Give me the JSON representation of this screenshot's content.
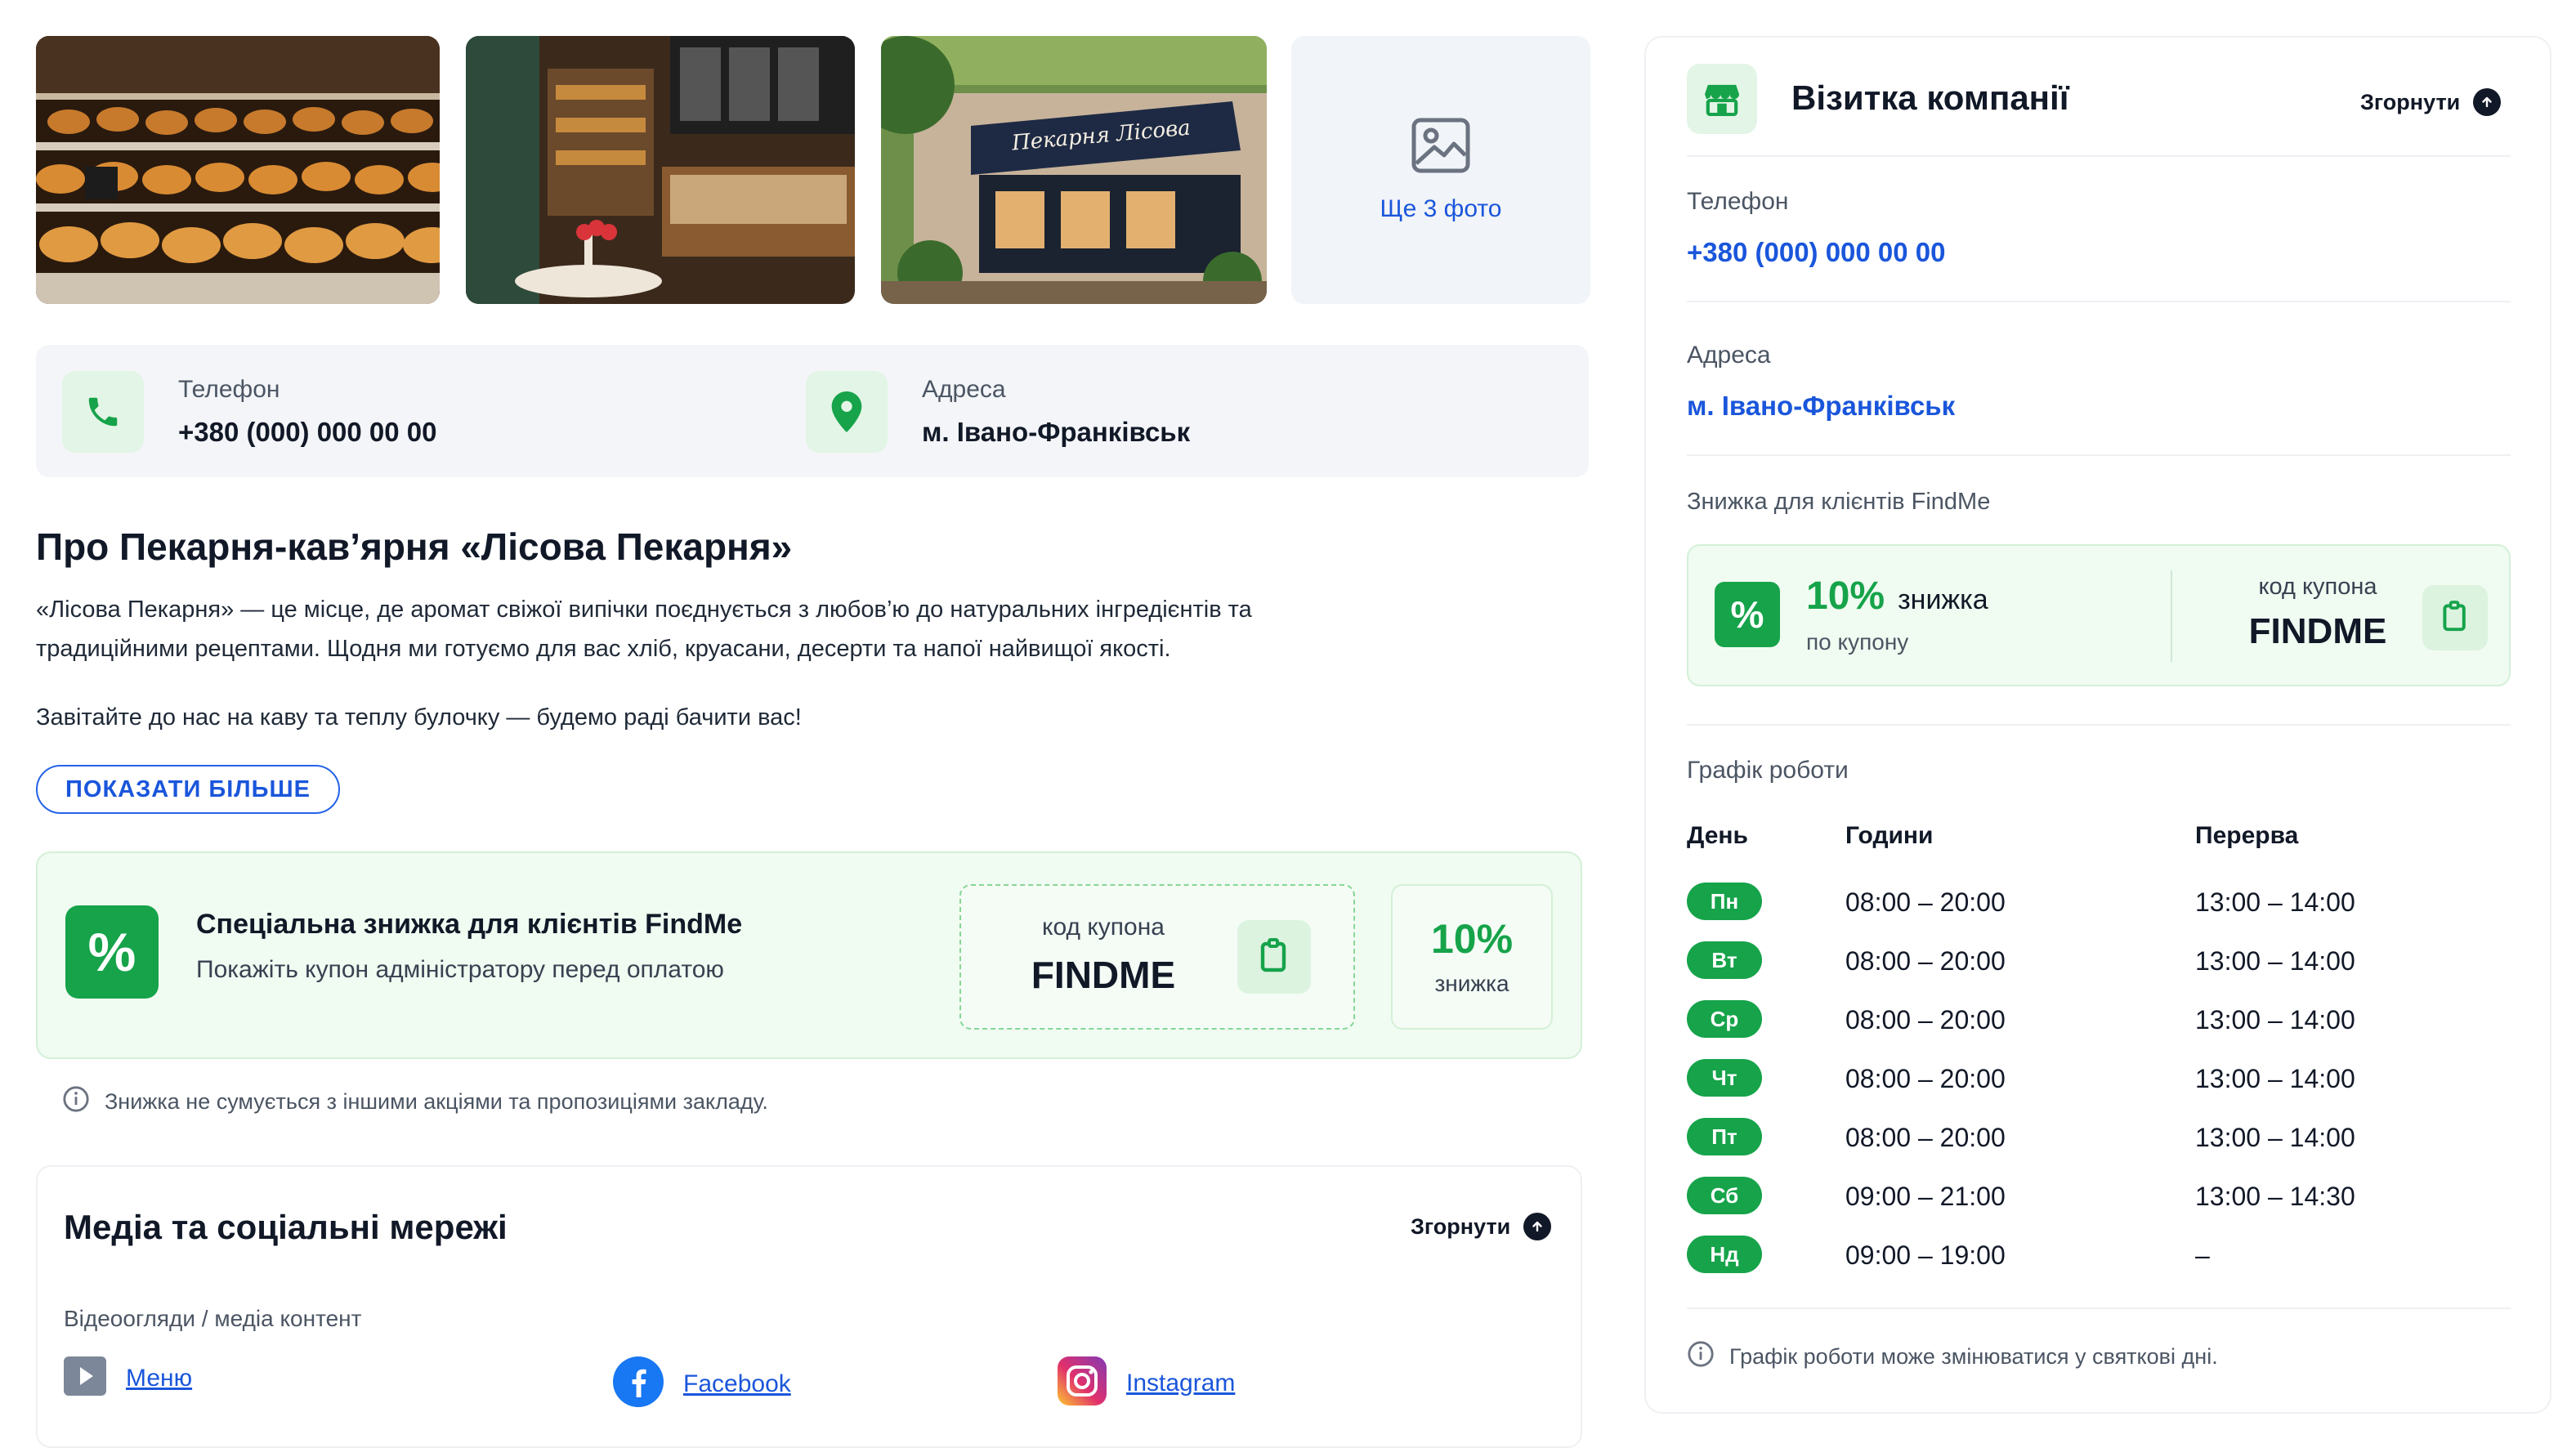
{
  "gallery": {
    "photo_sign": "Пекарня Лісова",
    "more_label": "Ще 3 фото"
  },
  "contacts": {
    "phone_label": "Телефон",
    "phone_value": "+380 (000) 000 00 00",
    "address_label": "Адреса",
    "address_value": "м. Івано-Франківськ"
  },
  "about": {
    "title": "Про Пекарня-кав’ярня «Лісова Пекарня»",
    "p1_line1": "«Лісова Пекарня» — це місце, де аромат свіжої випічки поєднується з любов’ю до натуральних інгредієнтів та",
    "p1_line2": "традиційними рецептами. Щодня ми готуємо для вас хліб, круасани, десерти та напої найвищої якості.",
    "p2": "Завітайте до нас на каву та теплу булочку — будемо раді бачити вас!",
    "show_more": "ПОКАЗАТИ БІЛЬШЕ"
  },
  "promo": {
    "icon_glyph": "%",
    "title": "Спеціальна знижка для клієнтів FindMe",
    "subtitle": "Покажіть купон адміністратору перед оплатою",
    "coupon_label": "код купона",
    "coupon_code": "FINDME",
    "discount_value": "10%",
    "discount_label": "знижка",
    "note": "Знижка не сумується з іншими акціями та пропозиціями закладу."
  },
  "media": {
    "title": "Медіа та соціальні мережі",
    "collapse_label": "Згорнути",
    "subtitle": "Відеоогляди / медіа контент",
    "links": [
      {
        "label": "Меню",
        "icon": "play-icon"
      },
      {
        "label": "Facebook",
        "icon": "facebook-icon"
      },
      {
        "label": "Instagram",
        "icon": "instagram-icon"
      }
    ]
  },
  "card": {
    "title": "Візитка компанії",
    "collapse_label": "Згорнути",
    "phone_label": "Телефон",
    "phone_value": "+380 (000) 000 00 00",
    "address_label": "Адреса",
    "address_value": "м. Івано-Франківськ",
    "discount_heading": "Знижка для клієнтів FindMe",
    "discount_value": "10%",
    "discount_word": "знижка",
    "discount_sub": "по купону",
    "coupon_label": "код купона",
    "coupon_code": "FINDME",
    "schedule_heading": "Графік роботи",
    "schedule_cols": [
      "День",
      "Години",
      "Перерва"
    ],
    "schedule": [
      {
        "day": "Пн",
        "hours": "08:00 – 20:00",
        "break": "13:00 – 14:00"
      },
      {
        "day": "Вт",
        "hours": "08:00 – 20:00",
        "break": "13:00 – 14:00"
      },
      {
        "day": "Ср",
        "hours": "08:00 – 20:00",
        "break": "13:00 – 14:00"
      },
      {
        "day": "Чт",
        "hours": "08:00 – 20:00",
        "break": "13:00 – 14:00"
      },
      {
        "day": "Пт",
        "hours": "08:00 – 20:00",
        "break": "13:00 – 14:00"
      },
      {
        "day": "Сб",
        "hours": "09:00 – 21:00",
        "break": "13:00 – 14:30"
      },
      {
        "day": "Нд",
        "hours": "09:00 – 19:00",
        "break": "–"
      }
    ],
    "schedule_note": "Графік роботи може змінюватися у святкові дні."
  },
  "colors": {
    "accent_green": "#16a34a",
    "link_blue": "#1a56db",
    "soft_green": "#f0fbf1"
  }
}
